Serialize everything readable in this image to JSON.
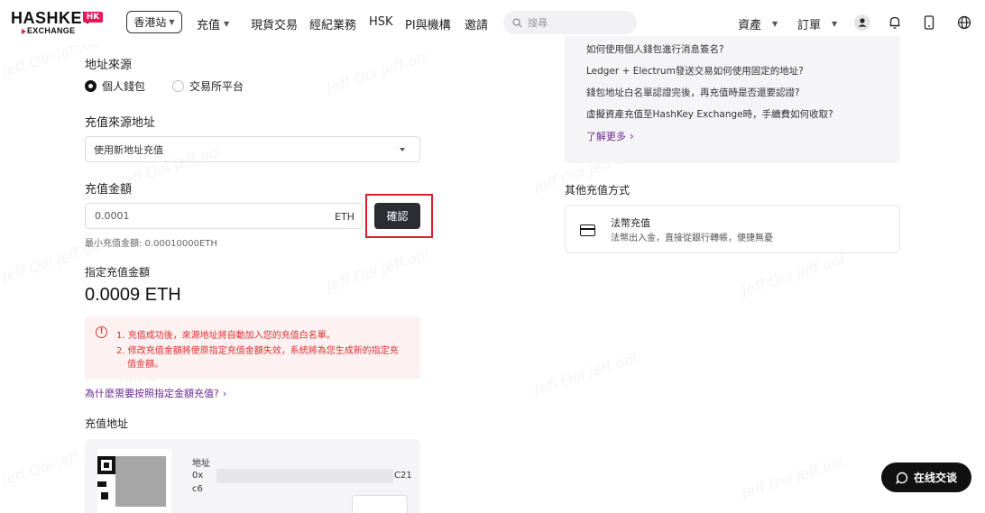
{
  "nav": {
    "logo_text": "HASHKEY",
    "logo_badge": "HK",
    "logo_sub": "EXCHANGE",
    "site_select": "香港站",
    "items": [
      {
        "label": "充值",
        "caret": true
      },
      {
        "label": "現貨交易",
        "caret": false
      },
      {
        "label": "經紀業務",
        "caret": false
      },
      {
        "label": "HSK",
        "caret": false
      },
      {
        "label": "PI與機構",
        "caret": false
      },
      {
        "label": "邀請",
        "caret": false
      }
    ],
    "search_placeholder": "搜尋",
    "assets": "資產",
    "orders": "訂單"
  },
  "form": {
    "source_addr_title": "地址來源",
    "radio_personal": "個人錢包",
    "radio_exchange": "交易所平台",
    "deposit_source_title": "充值來源地址",
    "select_value": "使用新地址充值",
    "amount_title": "充值金額",
    "amount_value": "0.0001",
    "amount_unit": "ETH",
    "confirm": "確認",
    "min_hint": "最小充值金額: 0.00010000ETH",
    "designated_title": "指定充值金額",
    "designated_value": "0.0009 ETH",
    "warn_1": "1. 充值成功後，來源地址將自動加入您的充值白名單。",
    "warn_2a": "2. 修改充值金額將使原指定充值金額失效，系統將為您生成新的指定充",
    "warn_2b": "值金額。",
    "why_link": "為什麼需要按照指定金額充值?",
    "deposit_addr_title": "充值地址",
    "addr_label": "地址",
    "addr_prefix": "0x",
    "addr_suffix": "C21",
    "addr_line2": "c6"
  },
  "faq": {
    "items": [
      "如何使用個人錢包進行消息簽名?",
      "Ledger + Electrum發送交易如何使用固定的地址?",
      "錢包地址白名單認證完後，再充值時是否還要認證?",
      "虛擬資產充值至HashKey Exchange時，手續費如何收取?"
    ],
    "more": "了解更多"
  },
  "other": {
    "title": "其他充值方式",
    "fiat_title": "法幣充值",
    "fiat_desc": "法幣出入金，直接從銀行轉帳，便捷無憂"
  },
  "chat": {
    "label": "在线交谈"
  },
  "watermark": "Jeff Ooi jeff.ooi",
  "colors": {
    "accent": "#6b2b8f",
    "brand": "#e5175b",
    "warning": "#d33333",
    "button": "#2b2d33"
  }
}
